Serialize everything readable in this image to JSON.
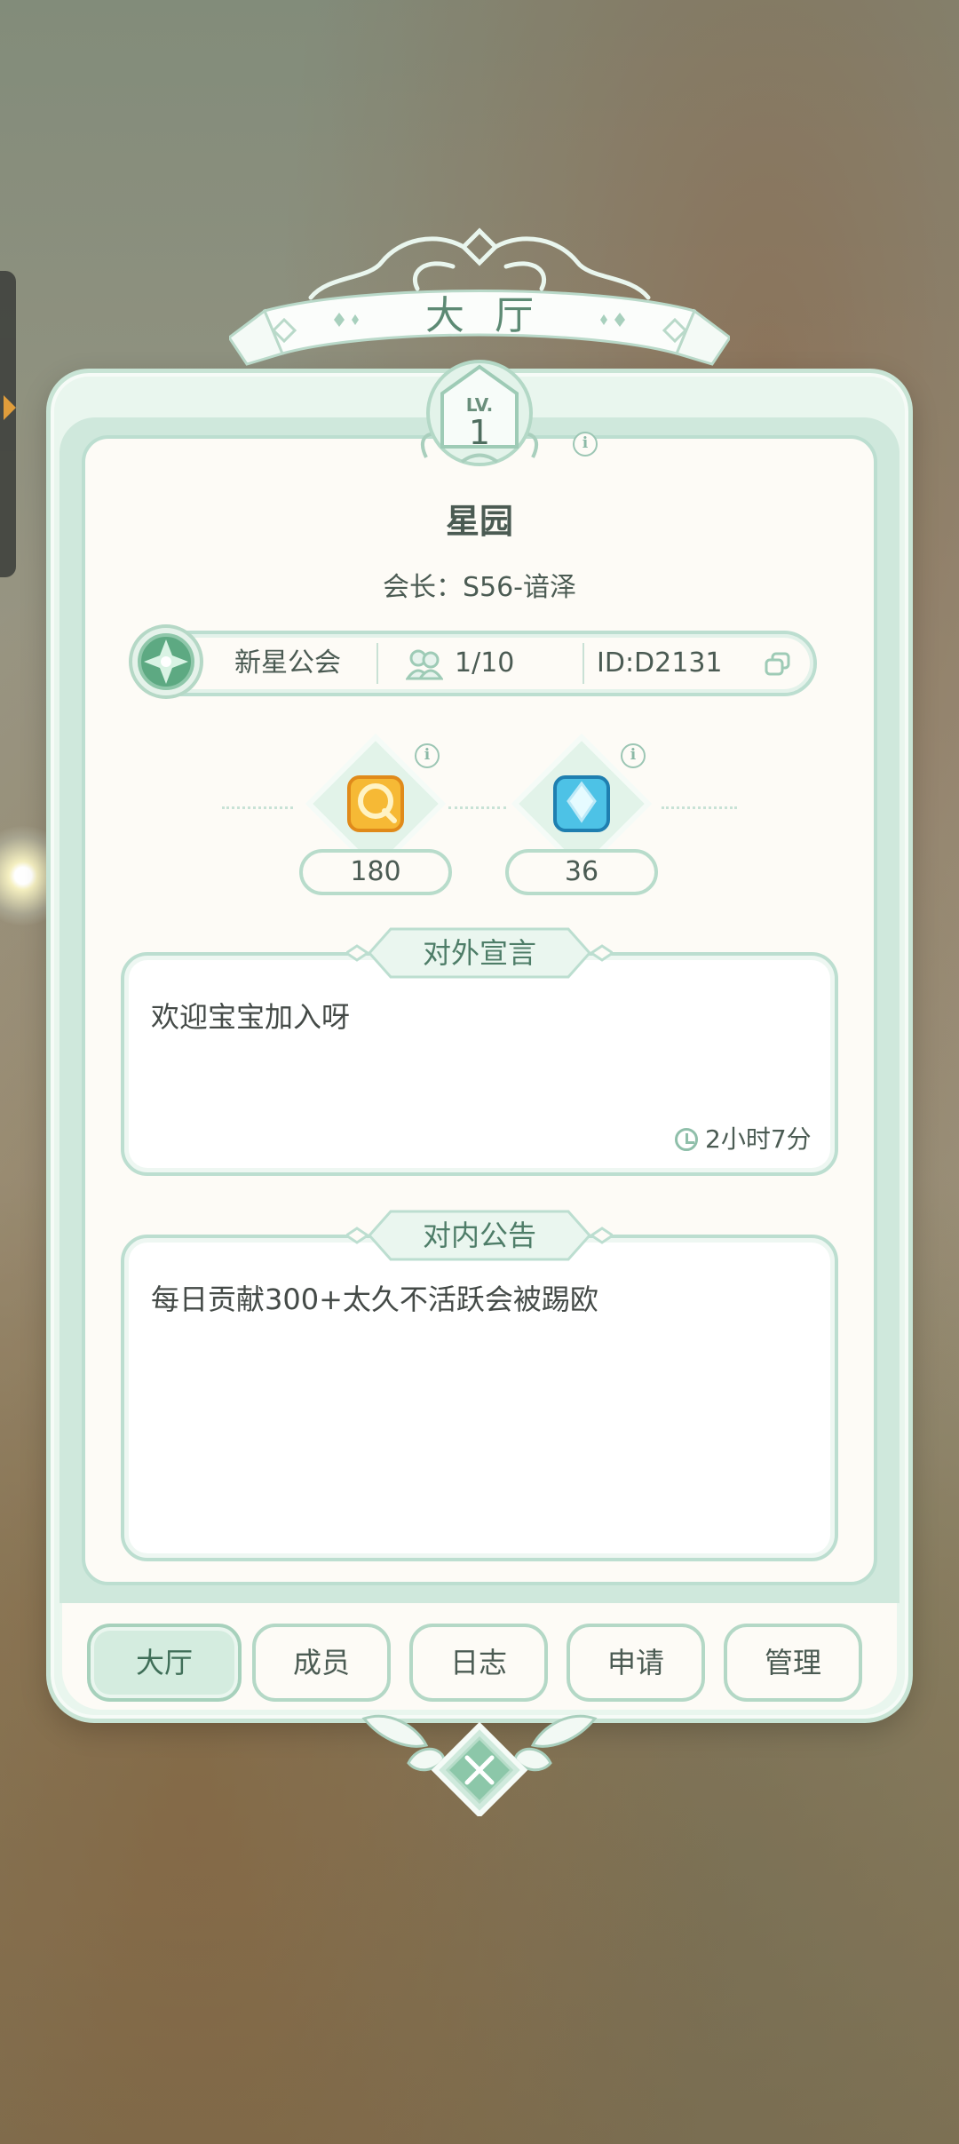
{
  "panel": {
    "title": "大厅",
    "level_prefix": "LV.",
    "level": "1"
  },
  "guild": {
    "name": "星园",
    "leader": "会长：S56-谙泽",
    "type": "新星公会",
    "members": "1/10",
    "id": "ID:D2131"
  },
  "currencies": [
    {
      "icon": "gold-badge-icon",
      "value": "180"
    },
    {
      "icon": "blue-crystal-icon",
      "value": "36"
    }
  ],
  "declaration": {
    "label": "对外宣言",
    "text": "欢迎宝宝加入呀",
    "time": "2小时7分"
  },
  "notice": {
    "label": "对内公告",
    "text": "每日贡献300+太久不活跃会被踢欧"
  },
  "tabs": [
    {
      "label": "大厅",
      "active": true
    },
    {
      "label": "成员",
      "active": false
    },
    {
      "label": "日志",
      "active": false
    },
    {
      "label": "申请",
      "active": false
    },
    {
      "label": "管理",
      "active": false
    }
  ],
  "colors": {
    "accent": "#5d8a74",
    "panel_bg": "#fdfbf6",
    "border": "#bcded0"
  }
}
